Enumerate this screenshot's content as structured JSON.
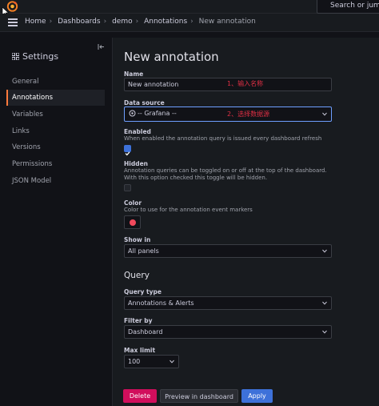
{
  "topbar": {
    "search_placeholder": "Search or jump to..."
  },
  "breadcrumb": {
    "items": [
      "Home",
      "Dashboards",
      "demo",
      "Annotations"
    ],
    "current": "New annotation"
  },
  "sidebar": {
    "title": "Settings",
    "items": [
      {
        "label": "General",
        "active": false
      },
      {
        "label": "Annotations",
        "active": true
      },
      {
        "label": "Variables",
        "active": false
      },
      {
        "label": "Links",
        "active": false
      },
      {
        "label": "Versions",
        "active": false
      },
      {
        "label": "Permissions",
        "active": false
      },
      {
        "label": "JSON Model",
        "active": false
      }
    ]
  },
  "form": {
    "title": "New annotation",
    "name_label": "Name",
    "name_value": "New annotation",
    "name_note": "1、输入名称",
    "datasource_label": "Data source",
    "datasource_value": "-- Grafana --",
    "datasource_note": "2、选择数据源",
    "enabled_label": "Enabled",
    "enabled_desc": "When enabled the annotation query is issued every dashboard refresh",
    "enabled_checked": true,
    "hidden_label": "Hidden",
    "hidden_desc": "Annotation queries can be toggled on or off at the top of the dashboard. With this option checked this toggle will be hidden.",
    "hidden_checked": false,
    "color_label": "Color",
    "color_desc": "Color to use for the annotation event markers",
    "color_value": "#f2495c",
    "showin_label": "Show in",
    "showin_value": "All panels",
    "query_heading": "Query",
    "querytype_label": "Query type",
    "querytype_value": "Annotations & Alerts",
    "filterby_label": "Filter by",
    "filterby_value": "Dashboard",
    "maxlimit_label": "Max limit",
    "maxlimit_value": "100"
  },
  "buttons": {
    "delete": "Delete",
    "preview": "Preview in dashboard",
    "apply": "Apply"
  }
}
